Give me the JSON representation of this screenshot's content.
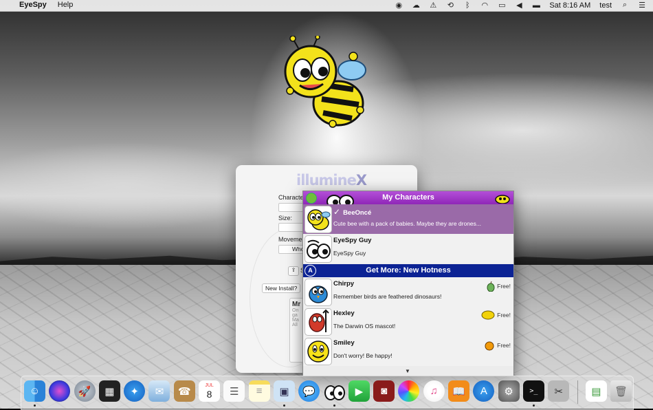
{
  "menubar": {
    "apple_icon": "apple-icon",
    "app_name": "EyeSpy",
    "menus": [
      "Help"
    ],
    "status_icons": [
      "eyespy-icon",
      "creative-cloud-icon",
      "battery-warning-icon",
      "time-machine-icon",
      "bluetooth-icon",
      "wifi-icon",
      "airplay-icon",
      "volume-icon",
      "battery-icon"
    ],
    "clock": "Sat 8:16 AM",
    "user": "test"
  },
  "app_window": {
    "logo": "illumine",
    "logo_x": "X",
    "labels": {
      "character": "Characte",
      "size": "Size:",
      "movement": "Moveme",
      "movement_value": "Who",
      "share_short": "S",
      "new_install": "New Install?",
      "mr_title": "Mr",
      "mr_lines": [
        "On",
        "ga",
        "Ma",
        "All"
      ]
    }
  },
  "popup": {
    "my_characters_header": "My Characters",
    "get_more_header": "Get More: New Hotness",
    "my_characters": [
      {
        "name": "BeeOncé",
        "description": "Cute bee with a pack of babies.  Maybe they are drones...",
        "selected": true,
        "checkmark": "✓"
      },
      {
        "name": "EyeSpy Guy",
        "description": "EyeSpy Guy",
        "selected": false
      }
    ],
    "store_items": [
      {
        "name": "Chirpy",
        "description": "Remember birds are feathered dinosaurs!",
        "price": "Free!",
        "price_icon": "pear-icon",
        "price_color": "#6db35a"
      },
      {
        "name": "Hexley",
        "description": "The Darwin OS mascot!",
        "price": "Free!",
        "price_icon": "lemon-icon",
        "price_color": "#f2d20a"
      },
      {
        "name": "Smiley",
        "description": "Don't worry! Be happy!",
        "price": "Free!",
        "price_icon": "orange-icon",
        "price_color": "#f29a0a"
      }
    ],
    "scroll_indicator": "▼"
  },
  "dock": {
    "apps": [
      "Finder",
      "Siri",
      "Launchpad",
      "Mission Control",
      "Safari",
      "Mail",
      "Contacts",
      "Calendar",
      "Reminders",
      "Notes",
      "Preview",
      "Messages",
      "EyeSpy",
      "FaceTime",
      "Photo Booth",
      "Photos",
      "iTunes",
      "iBooks",
      "App Store",
      "System Preferences",
      "Terminal",
      "Directory Utility",
      "Document",
      "Trash"
    ],
    "calendar_month": "JUL",
    "calendar_day": "8"
  }
}
